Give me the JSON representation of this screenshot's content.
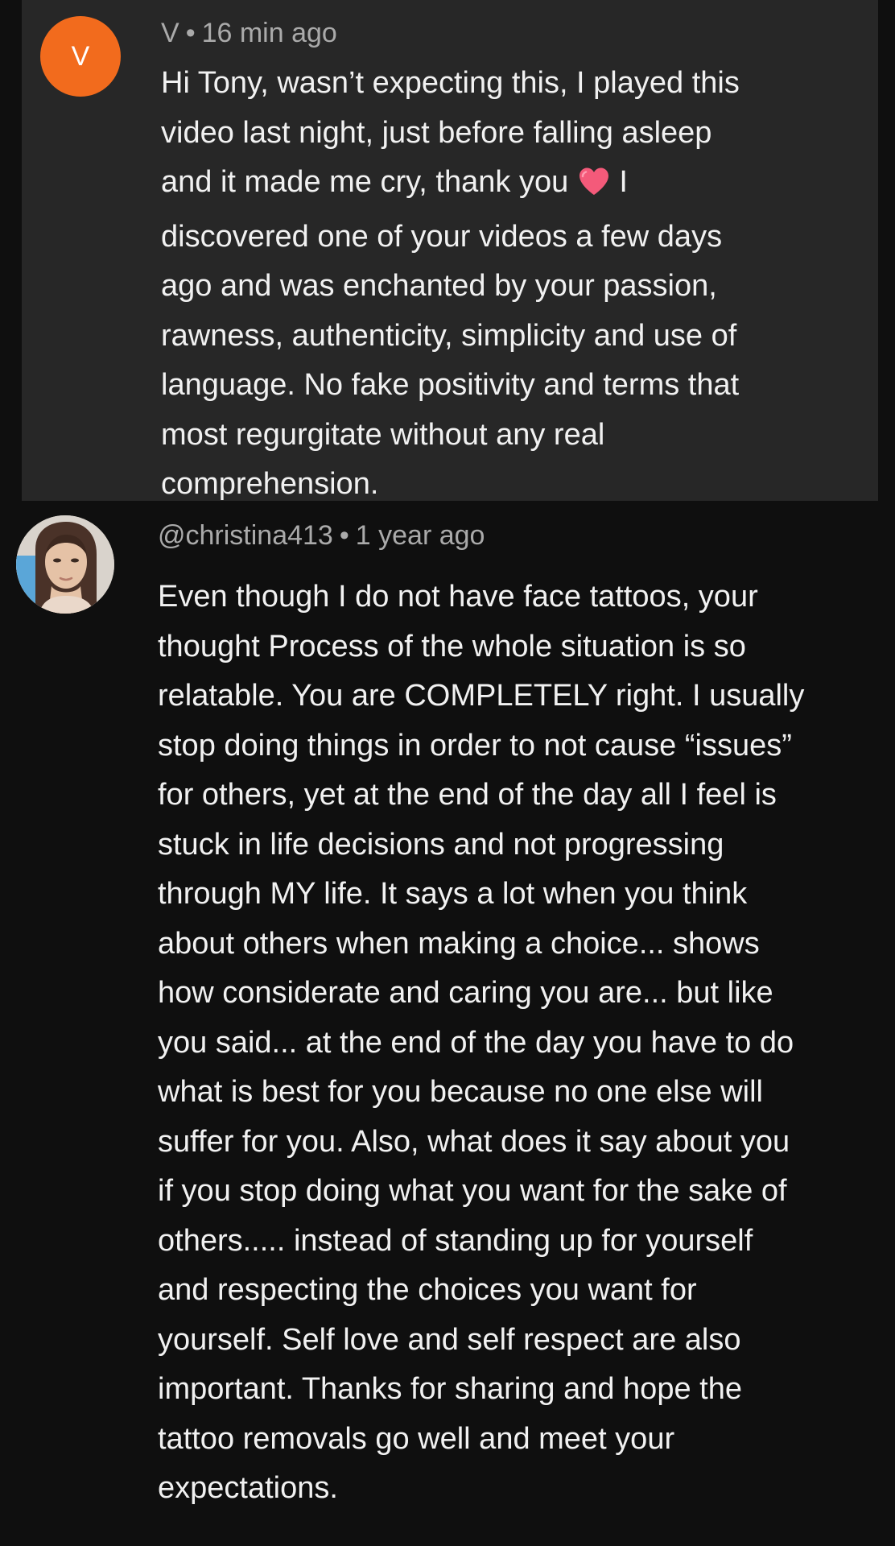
{
  "comments": [
    {
      "avatar_letter": "V",
      "author": "V",
      "time": "16 min ago",
      "text_part1": "Hi Tony, wasn’t expecting this, I played this\nvideo last night, just before falling asleep\nand it made me cry, thank you ",
      "text_part2": " I\ndiscovered one of your videos a few days\nago and was enchanted by your passion,\nrawness, authenticity, simplicity and use of\nlanguage. No fake positivity and terms that\nmost regurgitate without any real\ncomprehension.",
      "avatar_color": "#f26b1d",
      "heart_icon": "heart-emoji"
    },
    {
      "author": "@christina413",
      "time": "1 year ago",
      "text": "Even though I do not have face tattoos, your\nthought Process of the whole situation is so\nrelatable. You are COMPLETELY right. I usually\nstop doing things in order to not cause “issues”\nfor others, yet at the end of the day all I feel is\nstuck in life decisions and not progressing\nthrough MY life. It says a lot when you think\nabout others when making a choice... shows\nhow considerate and caring you are... but like\nyou said... at the end of the day you have to do\nwhat is best for you because no one else will\nsuffer for you. Also, what does it say about you\nif you stop doing what you want for the sake of\nothers..... instead of standing up for yourself\nand respecting the choices you want for\nyourself. Self love and self respect are also\nimportant. Thanks for sharing and hope the\ntattoo removals go well and meet your\nexpectations.",
      "avatar_type": "photo"
    }
  ],
  "separator": "•",
  "theme": {
    "background": "#0f0f0f",
    "highlight": "#272727",
    "meta_color": "#aaaaaa",
    "text_color": "#f1f1f1"
  }
}
